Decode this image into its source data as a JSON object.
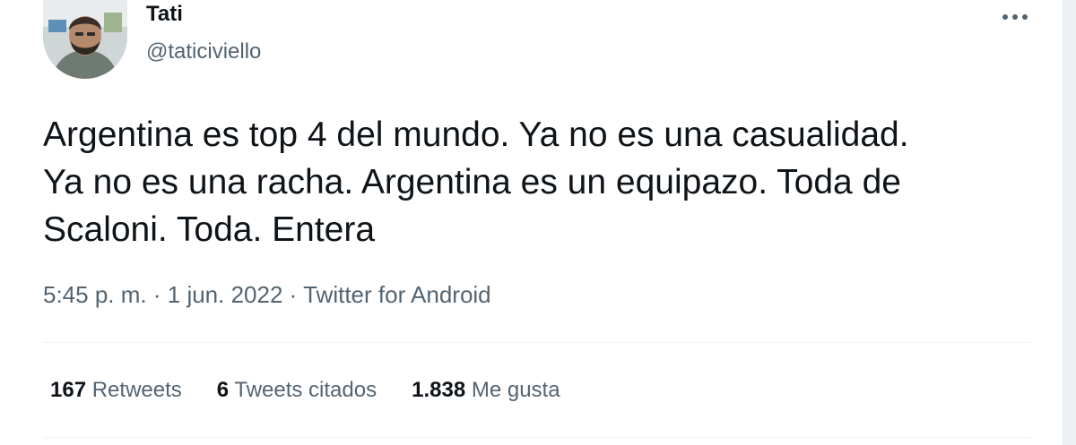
{
  "tweet": {
    "author": {
      "display_name": "Tati",
      "handle": "@taticiviello"
    },
    "text": "Argentina es top 4 del mundo. Ya no es una casualidad. Ya no es una racha. Argentina es un equipazo. Toda de Scaloni. Toda. Entera",
    "time": "5:45 p. m.",
    "date": "1 jun. 2022",
    "source": "Twitter for Android",
    "separator": "·",
    "stats": [
      {
        "count": "167",
        "label": "Retweets"
      },
      {
        "count": "6",
        "label": "Tweets citados"
      },
      {
        "count": "1.838",
        "label": "Me gusta"
      }
    ]
  },
  "icons": {
    "more": "more-horizontal-icon"
  },
  "colors": {
    "text_primary": "#0f1419",
    "text_secondary": "#536471",
    "divider": "#eff3f4"
  }
}
